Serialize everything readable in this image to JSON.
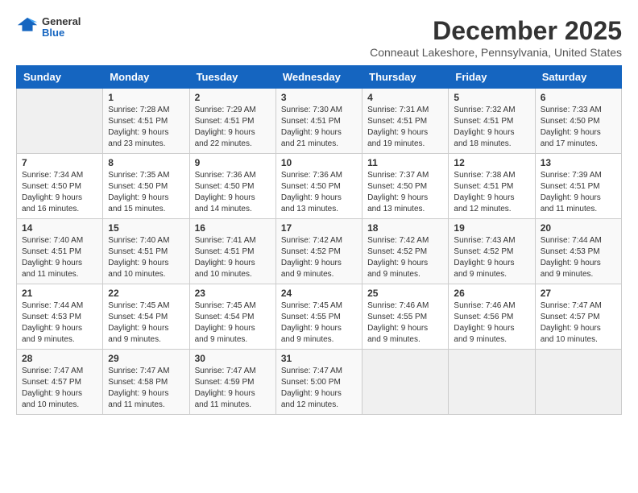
{
  "logo": {
    "general": "General",
    "blue": "Blue"
  },
  "header": {
    "month_title": "December 2025",
    "location": "Conneaut Lakeshore, Pennsylvania, United States"
  },
  "days_of_week": [
    "Sunday",
    "Monday",
    "Tuesday",
    "Wednesday",
    "Thursday",
    "Friday",
    "Saturday"
  ],
  "weeks": [
    [
      {
        "day": "",
        "info": ""
      },
      {
        "day": "1",
        "info": "Sunrise: 7:28 AM\nSunset: 4:51 PM\nDaylight: 9 hours\nand 23 minutes."
      },
      {
        "day": "2",
        "info": "Sunrise: 7:29 AM\nSunset: 4:51 PM\nDaylight: 9 hours\nand 22 minutes."
      },
      {
        "day": "3",
        "info": "Sunrise: 7:30 AM\nSunset: 4:51 PM\nDaylight: 9 hours\nand 21 minutes."
      },
      {
        "day": "4",
        "info": "Sunrise: 7:31 AM\nSunset: 4:51 PM\nDaylight: 9 hours\nand 19 minutes."
      },
      {
        "day": "5",
        "info": "Sunrise: 7:32 AM\nSunset: 4:51 PM\nDaylight: 9 hours\nand 18 minutes."
      },
      {
        "day": "6",
        "info": "Sunrise: 7:33 AM\nSunset: 4:50 PM\nDaylight: 9 hours\nand 17 minutes."
      }
    ],
    [
      {
        "day": "7",
        "info": "Sunrise: 7:34 AM\nSunset: 4:50 PM\nDaylight: 9 hours\nand 16 minutes."
      },
      {
        "day": "8",
        "info": "Sunrise: 7:35 AM\nSunset: 4:50 PM\nDaylight: 9 hours\nand 15 minutes."
      },
      {
        "day": "9",
        "info": "Sunrise: 7:36 AM\nSunset: 4:50 PM\nDaylight: 9 hours\nand 14 minutes."
      },
      {
        "day": "10",
        "info": "Sunrise: 7:36 AM\nSunset: 4:50 PM\nDaylight: 9 hours\nand 13 minutes."
      },
      {
        "day": "11",
        "info": "Sunrise: 7:37 AM\nSunset: 4:50 PM\nDaylight: 9 hours\nand 13 minutes."
      },
      {
        "day": "12",
        "info": "Sunrise: 7:38 AM\nSunset: 4:51 PM\nDaylight: 9 hours\nand 12 minutes."
      },
      {
        "day": "13",
        "info": "Sunrise: 7:39 AM\nSunset: 4:51 PM\nDaylight: 9 hours\nand 11 minutes."
      }
    ],
    [
      {
        "day": "14",
        "info": "Sunrise: 7:40 AM\nSunset: 4:51 PM\nDaylight: 9 hours\nand 11 minutes."
      },
      {
        "day": "15",
        "info": "Sunrise: 7:40 AM\nSunset: 4:51 PM\nDaylight: 9 hours\nand 10 minutes."
      },
      {
        "day": "16",
        "info": "Sunrise: 7:41 AM\nSunset: 4:51 PM\nDaylight: 9 hours\nand 10 minutes."
      },
      {
        "day": "17",
        "info": "Sunrise: 7:42 AM\nSunset: 4:52 PM\nDaylight: 9 hours\nand 9 minutes."
      },
      {
        "day": "18",
        "info": "Sunrise: 7:42 AM\nSunset: 4:52 PM\nDaylight: 9 hours\nand 9 minutes."
      },
      {
        "day": "19",
        "info": "Sunrise: 7:43 AM\nSunset: 4:52 PM\nDaylight: 9 hours\nand 9 minutes."
      },
      {
        "day": "20",
        "info": "Sunrise: 7:44 AM\nSunset: 4:53 PM\nDaylight: 9 hours\nand 9 minutes."
      }
    ],
    [
      {
        "day": "21",
        "info": "Sunrise: 7:44 AM\nSunset: 4:53 PM\nDaylight: 9 hours\nand 9 minutes."
      },
      {
        "day": "22",
        "info": "Sunrise: 7:45 AM\nSunset: 4:54 PM\nDaylight: 9 hours\nand 9 minutes."
      },
      {
        "day": "23",
        "info": "Sunrise: 7:45 AM\nSunset: 4:54 PM\nDaylight: 9 hours\nand 9 minutes."
      },
      {
        "day": "24",
        "info": "Sunrise: 7:45 AM\nSunset: 4:55 PM\nDaylight: 9 hours\nand 9 minutes."
      },
      {
        "day": "25",
        "info": "Sunrise: 7:46 AM\nSunset: 4:55 PM\nDaylight: 9 hours\nand 9 minutes."
      },
      {
        "day": "26",
        "info": "Sunrise: 7:46 AM\nSunset: 4:56 PM\nDaylight: 9 hours\nand 9 minutes."
      },
      {
        "day": "27",
        "info": "Sunrise: 7:47 AM\nSunset: 4:57 PM\nDaylight: 9 hours\nand 10 minutes."
      }
    ],
    [
      {
        "day": "28",
        "info": "Sunrise: 7:47 AM\nSunset: 4:57 PM\nDaylight: 9 hours\nand 10 minutes."
      },
      {
        "day": "29",
        "info": "Sunrise: 7:47 AM\nSunset: 4:58 PM\nDaylight: 9 hours\nand 11 minutes."
      },
      {
        "day": "30",
        "info": "Sunrise: 7:47 AM\nSunset: 4:59 PM\nDaylight: 9 hours\nand 11 minutes."
      },
      {
        "day": "31",
        "info": "Sunrise: 7:47 AM\nSunset: 5:00 PM\nDaylight: 9 hours\nand 12 minutes."
      },
      {
        "day": "",
        "info": ""
      },
      {
        "day": "",
        "info": ""
      },
      {
        "day": "",
        "info": ""
      }
    ]
  ]
}
